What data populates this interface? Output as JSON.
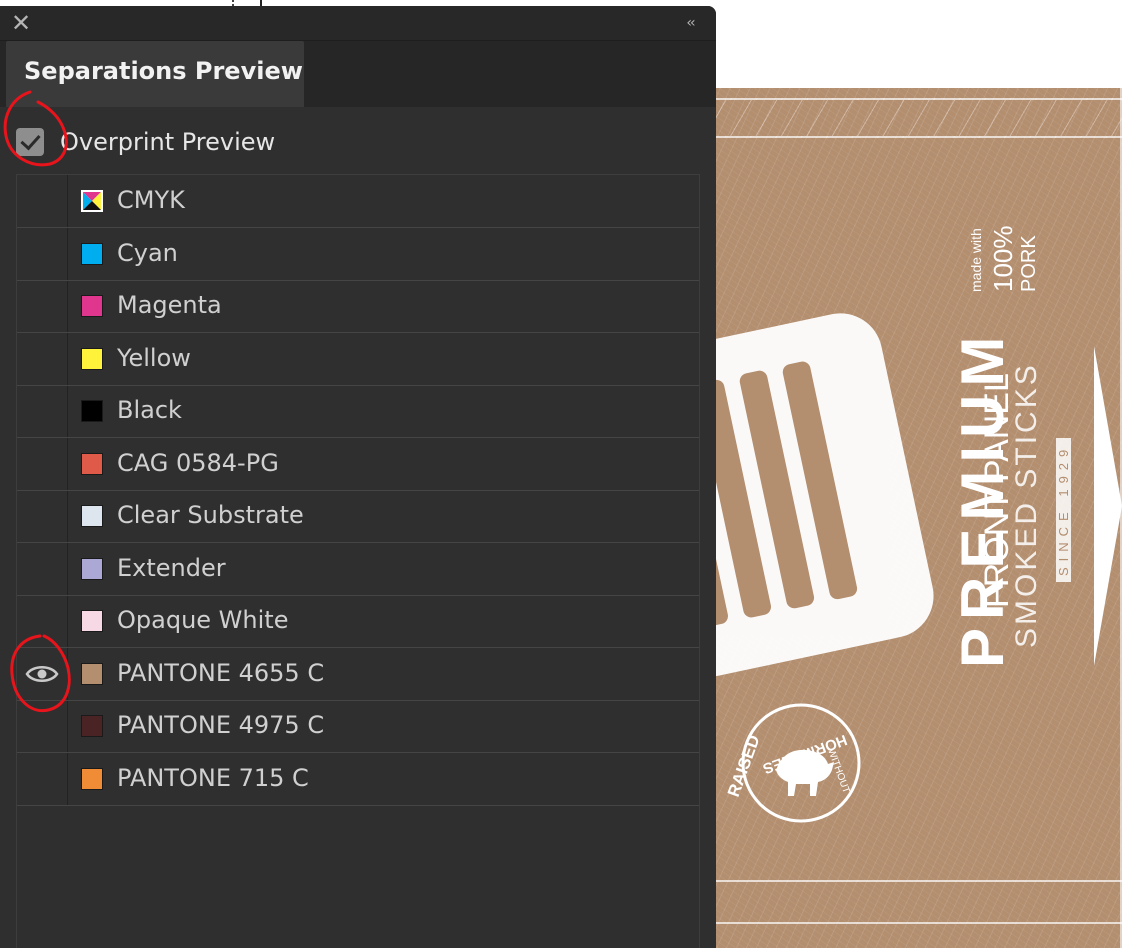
{
  "panel": {
    "close_icon": "close-icon",
    "collapse_icon": "double-chevron-left-icon",
    "collapse_glyph": "‹‹",
    "tab_title": "Separations Preview",
    "overprint": {
      "label": "Overprint Preview",
      "checked": true
    }
  },
  "separations": [
    {
      "label": "CMYK",
      "color": "cmyk",
      "visible": false
    },
    {
      "label": "Cyan",
      "color": "#00aeef",
      "visible": false
    },
    {
      "label": "Magenta",
      "color": "#e0368d",
      "visible": false
    },
    {
      "label": "Yellow",
      "color": "#fff23a",
      "visible": false
    },
    {
      "label": "Black",
      "color": "#000000",
      "visible": false
    },
    {
      "label": "CAG 0584-PG",
      "color": "#e05a4a",
      "visible": false
    },
    {
      "label": "Clear Substrate",
      "color": "#dde6ee",
      "visible": false
    },
    {
      "label": "Extender",
      "color": "#aba8d6",
      "visible": false
    },
    {
      "label": "Opaque White",
      "color": "#f7d9e5",
      "visible": false
    },
    {
      "label": "PANTONE 4655 C",
      "color": "#b38e6f",
      "visible": true
    },
    {
      "label": "PANTONE 4975 C",
      "color": "#4a2424",
      "visible": false
    },
    {
      "label": "PANTONE 715 C",
      "color": "#f08c36",
      "visible": false
    }
  ],
  "artboard": {
    "background": "#b38e6f",
    "made_with": "made with",
    "percent": "100%",
    "pork": "PORK",
    "premium": "PREMIUM",
    "front_panel": "FRONT PANEL",
    "smoked": "SMOKED STICKS",
    "since": "SINCE 1929",
    "badge_raised": "RAISED",
    "badge_without": "WITHOUT",
    "badge_hormones": "HORMONES"
  },
  "annotation_color": "#e8141c"
}
